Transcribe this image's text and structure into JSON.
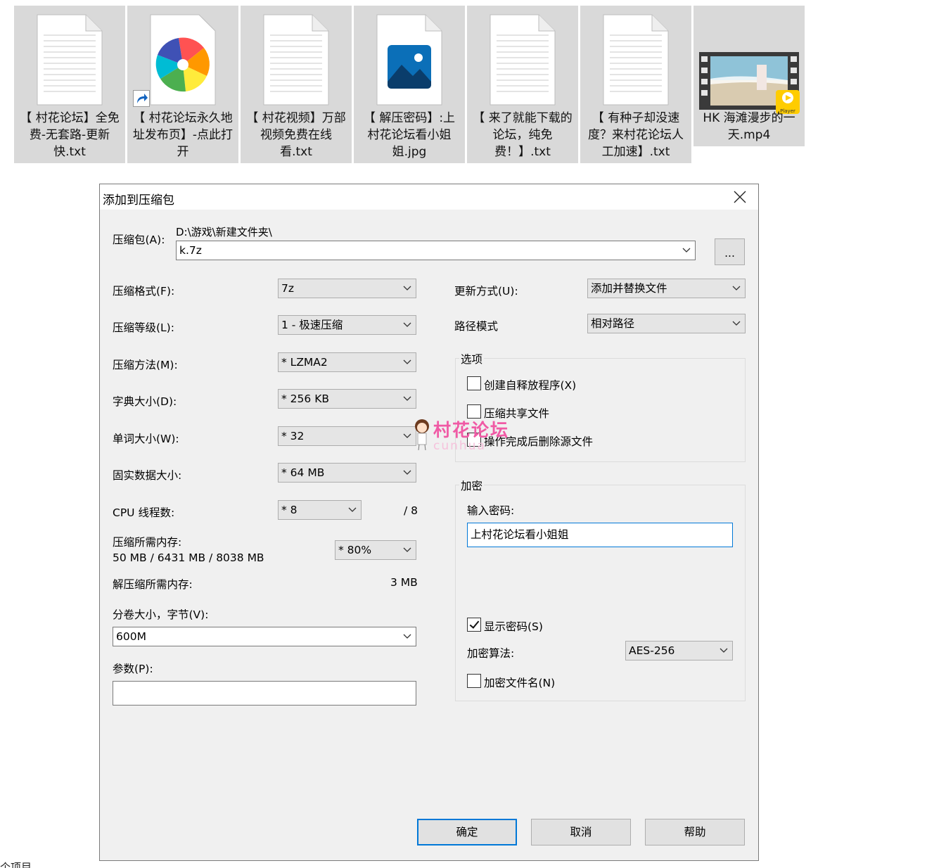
{
  "files": [
    {
      "name": "【 村花论坛】全免费-无套路-更新快.txt",
      "icon": "text-document-icon"
    },
    {
      "name": "【 村花论坛永久地址发布页】-点此打开",
      "icon": "pinwheel-browser-icon"
    },
    {
      "name": "【 村花视频】万部视频免费在线看.txt",
      "icon": "text-document-icon"
    },
    {
      "name": "【 解压密码】:上村花论坛看小姐姐.jpg",
      "icon": "image-file-icon"
    },
    {
      "name": "【 来了就能下载的论坛，纯免费！】.txt",
      "icon": "text-document-icon"
    },
    {
      "name": "【 有种子却没速度？来村花论坛人工加速】.txt",
      "icon": "text-document-icon"
    },
    {
      "name": "HK 海滩漫步的一天.mp4",
      "icon": "video-thumbnail-icon",
      "badge": "Player"
    }
  ],
  "dialog": {
    "title": "添加到压缩包",
    "archive_label": "压缩包(A):",
    "archive_path": "D:\\游戏\\新建文件夹\\",
    "archive_name": "k.7z",
    "browse_label": "...",
    "left": {
      "format_label": "压缩格式(F):",
      "format_value": "7z",
      "level_label": "压缩等级(L):",
      "level_value": "1 - 极速压缩",
      "method_label": "压缩方法(M):",
      "method_value": "*  LZMA2",
      "dict_label": "字典大小(D):",
      "dict_value": "*  256 KB",
      "word_label": "单词大小(W):",
      "word_value": "*  32",
      "solid_label": "固实数据大小:",
      "solid_value": "*  64 MB",
      "cpu_label": "CPU 线程数:",
      "cpu_value": "*  8",
      "cpu_max": "/ 8",
      "mem_label": "压缩所需内存:",
      "mem_detail": "50 MB / 6431 MB / 8038 MB",
      "mem_value": "* 80%",
      "decomp_label": "解压缩所需内存:",
      "decomp_value": "3 MB",
      "volume_label": "分卷大小，字节(V):",
      "volume_value": "600M",
      "params_label": "参数(P):",
      "params_value": ""
    },
    "right": {
      "update_label": "更新方式(U):",
      "update_value": "添加并替换文件",
      "path_label": "路径模式",
      "path_value": "相对路径",
      "options_title": "选项",
      "options": [
        {
          "label": "创建自释放程序(X)",
          "checked": false
        },
        {
          "label": "压缩共享文件",
          "checked": false
        },
        {
          "label": "操作完成后删除源文件",
          "checked": false
        }
      ],
      "encrypt_title": "加密",
      "password_label": "输入密码:",
      "password_value": "上村花论坛看小姐姐",
      "show_password_label": "显示密码(S)",
      "show_password_checked": true,
      "algo_label": "加密算法:",
      "algo_value": "AES-256",
      "encrypt_names_label": "加密文件名(N)",
      "encrypt_names_checked": false
    },
    "buttons": {
      "ok": "确定",
      "cancel": "取消",
      "help": "帮助"
    }
  },
  "watermark": {
    "text": "村花论坛",
    "sub": "cunhua"
  },
  "footer": "个项目"
}
